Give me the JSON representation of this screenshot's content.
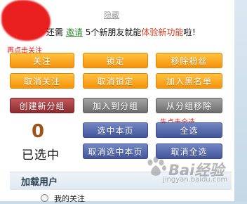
{
  "header": {
    "hide_link": "隐藏",
    "invite_prefix": "还需",
    "invite_link": "邀请",
    "invite_middle": " 5个新朋友就能",
    "invite_feature": "体验新功能",
    "invite_suffix": "啦！"
  },
  "annotations": {
    "click_follow": "再点击关注",
    "click_select_all": "先点击全选"
  },
  "buttons": {
    "follow": "关注",
    "lock": "锁定",
    "remove_fans": "移除粉丝",
    "unfollow": "取消关注",
    "unlock": "取消锁定",
    "blacklist": "加入黑名单",
    "create_group": "创建新分组",
    "add_to_group": "加入到分组",
    "remove_from_group": "从分组移除",
    "select_page": "选中本页",
    "select_all": "全选",
    "deselect_page": "取消选中本页",
    "deselect_all": "取消全选"
  },
  "selection": {
    "count": "0",
    "label": "已选中"
  },
  "load_users": {
    "title": "加载用户",
    "option_my_follows": "我的关注"
  },
  "watermark": {
    "brand": "Bai经验",
    "url": "jingyan.baidu.com",
    "icon": "baidu-paw-icon"
  }
}
